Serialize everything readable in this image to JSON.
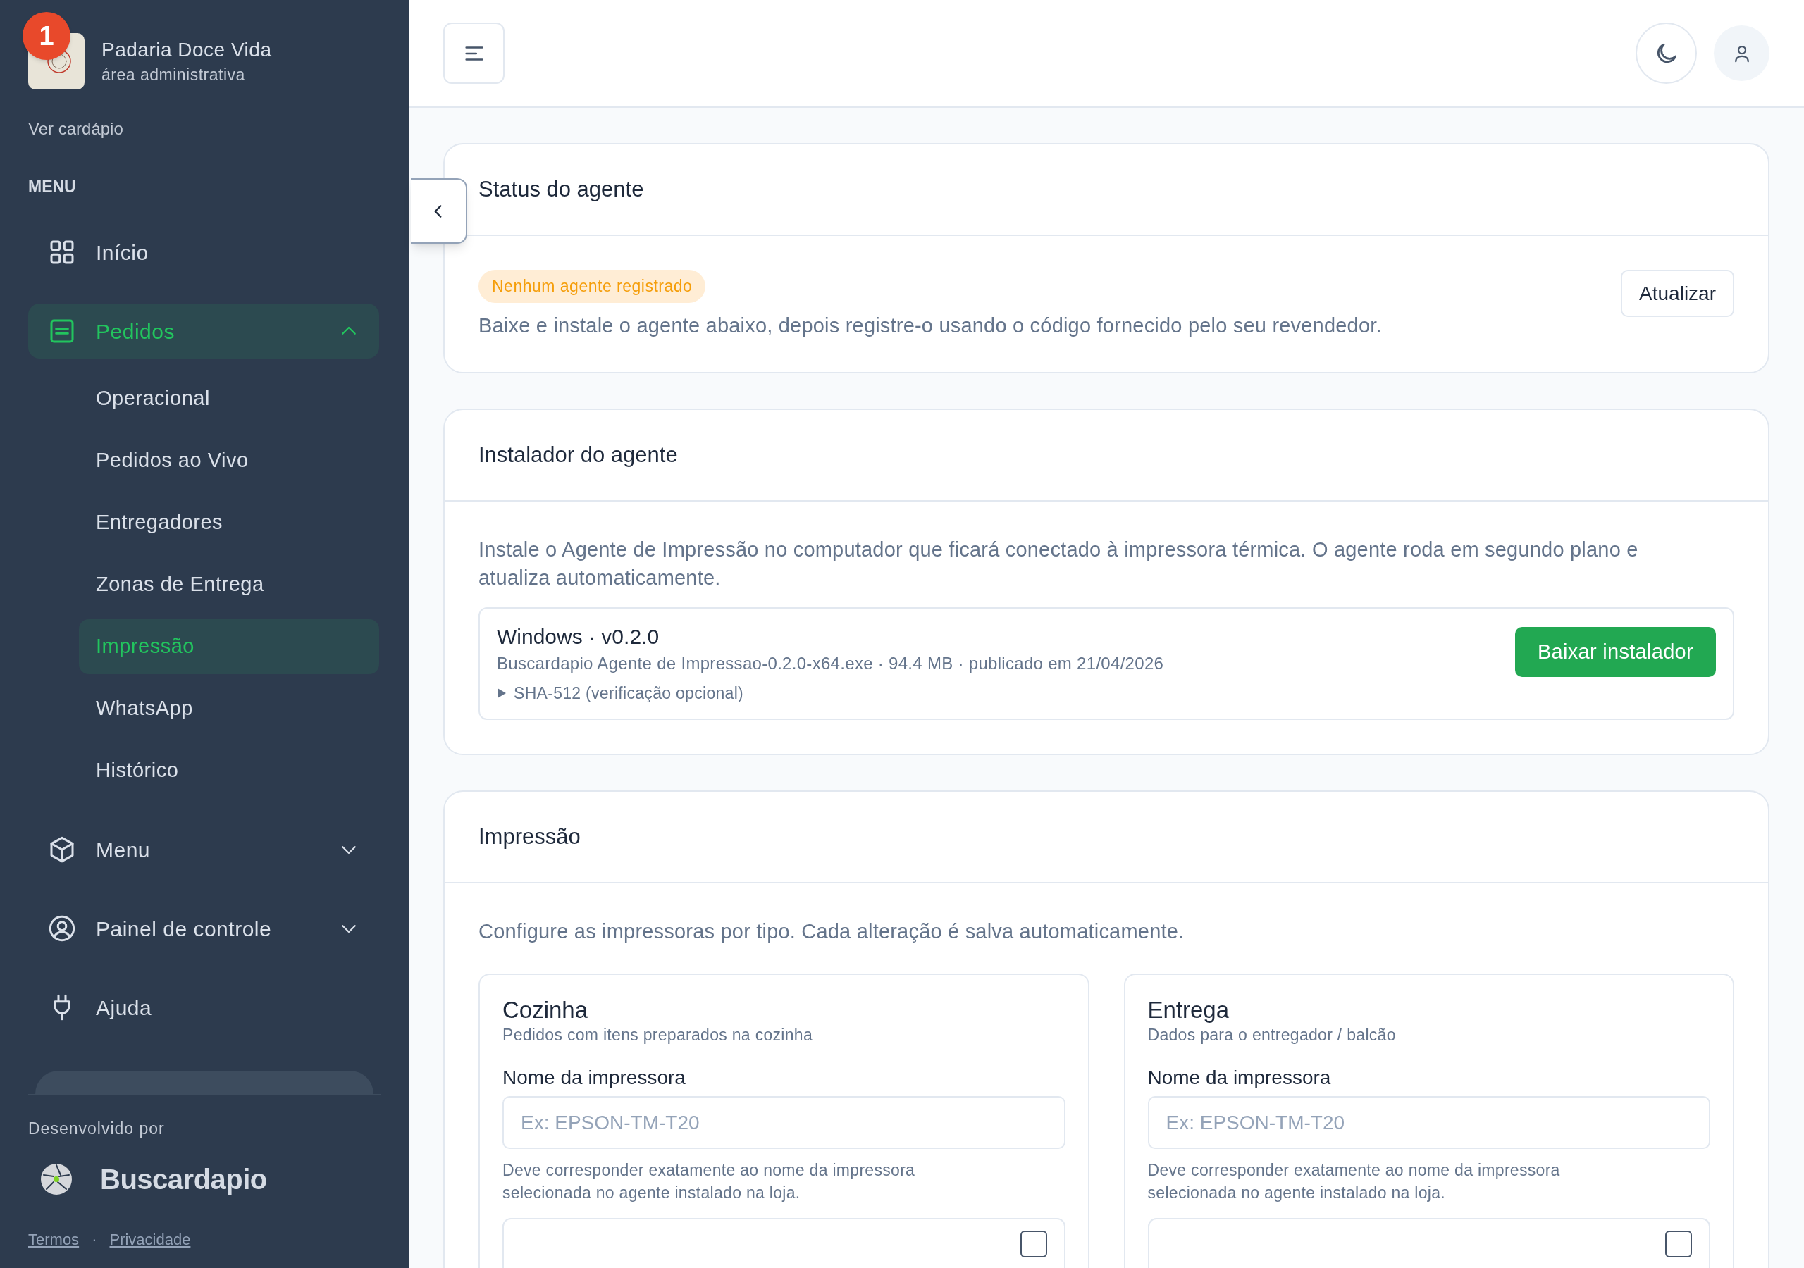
{
  "sidebar": {
    "brand": {
      "name": "Padaria Doce Vida",
      "subtitle": "área administrativa",
      "badge": "1"
    },
    "menu_link": "Ver cardápio",
    "section_label": "MENU",
    "items": [
      {
        "kind": "link",
        "label": "Início",
        "selected": false
      },
      {
        "kind": "group",
        "label": "Pedidos",
        "selected": true,
        "expanded": true,
        "children": [
          {
            "label": "Operacional",
            "selected": false
          },
          {
            "label": "Pedidos ao Vivo",
            "selected": false
          },
          {
            "label": "Entregadores",
            "selected": false
          },
          {
            "label": "Zonas de Entrega",
            "selected": false
          },
          {
            "label": "Impressão",
            "selected": true
          },
          {
            "label": "WhatsApp",
            "selected": false
          },
          {
            "label": "Histórico",
            "selected": false
          }
        ]
      },
      {
        "kind": "group",
        "label": "Menu",
        "selected": false,
        "expanded": false
      },
      {
        "kind": "group",
        "label": "Painel de controle",
        "selected": false,
        "expanded": false
      },
      {
        "kind": "link",
        "label": "Ajuda",
        "selected": false
      }
    ],
    "footer": {
      "developed_by": "Desenvolvido por",
      "brand": "Buscardapio",
      "links": [
        "Termos",
        "Privacidade"
      ],
      "separator": "·"
    }
  },
  "status_card": {
    "title": "Status do agente",
    "badge": "Nenhum agente registrado",
    "description": "Baixe e instale o agente abaixo, depois registre-o usando o código fornecido pelo seu revendedor.",
    "refresh_button": "Atualizar"
  },
  "installer_card": {
    "title": "Instalador do agente",
    "description": "Instale o Agente de Impressão no computador que ficará conectado à impressora térmica. O agente roda em segundo plano e atualiza automaticamente.",
    "package": {
      "title": "Windows · v0.2.0",
      "details": "Buscardapio Agente de Impressao-0.2.0-x64.exe · 94.4 MB · publicado em 21/04/2026",
      "checksum_toggle": "SHA-512 (verificação opcional)",
      "download_button": "Baixar instalador"
    }
  },
  "printing_card": {
    "title": "Impressão",
    "description": "Configure as impressoras por tipo. Cada alteração é salva automaticamente.",
    "printers": [
      {
        "title": "Cozinha",
        "subtitle": "Pedidos com itens preparados na cozinha",
        "field_label": "Nome da impressora",
        "placeholder": "Ex: EPSON-TM-T20",
        "help": "Deve corresponder exatamente ao nome da impressora selecionada no agente instalado na loja.",
        "checked": false
      },
      {
        "title": "Entrega",
        "subtitle": "Dados para o entregador / balcão",
        "field_label": "Nome da impressora",
        "placeholder": "Ex: EPSON-TM-T20",
        "help": "Deve corresponder exatamente ao nome da impressora selecionada no agente instalado na loja.",
        "checked": false
      }
    ]
  }
}
